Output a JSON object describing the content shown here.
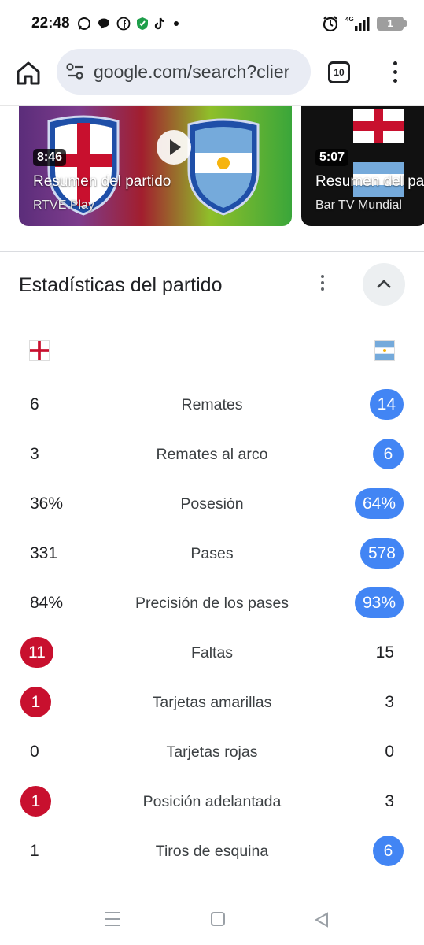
{
  "status_bar": {
    "time": "22:48",
    "network": "4G",
    "battery": "1"
  },
  "browser": {
    "url": "google.com/search?clier",
    "tab_count": "10"
  },
  "videos": [
    {
      "duration": "8:46",
      "title": "Resumen del partido",
      "source": "RTVE Play"
    },
    {
      "duration": "5:07",
      "title": "Resumen del partido",
      "source": "Bar TV Mundial"
    }
  ],
  "stats": {
    "title": "Estadísticas del partido",
    "rows": [
      {
        "label": "Remates",
        "left": "6",
        "right": "14",
        "highlight": "right"
      },
      {
        "label": "Remates al arco",
        "left": "3",
        "right": "6",
        "highlight": "right"
      },
      {
        "label": "Posesión",
        "left": "36%",
        "right": "64%",
        "highlight": "right"
      },
      {
        "label": "Pases",
        "left": "331",
        "right": "578",
        "highlight": "right"
      },
      {
        "label": "Precisión de los pases",
        "left": "84%",
        "right": "93%",
        "highlight": "right"
      },
      {
        "label": "Faltas",
        "left": "11",
        "right": "15",
        "highlight": "left"
      },
      {
        "label": "Tarjetas amarillas",
        "left": "1",
        "right": "3",
        "highlight": "left"
      },
      {
        "label": "Tarjetas rojas",
        "left": "0",
        "right": "0",
        "highlight": "none"
      },
      {
        "label": "Posición adelantada",
        "left": "1",
        "right": "3",
        "highlight": "left"
      },
      {
        "label": "Tiros de esquina",
        "left": "1",
        "right": "6",
        "highlight": "right"
      }
    ]
  },
  "colors": {
    "left_highlight": "#c8102e",
    "right_highlight": "#4285f4"
  }
}
